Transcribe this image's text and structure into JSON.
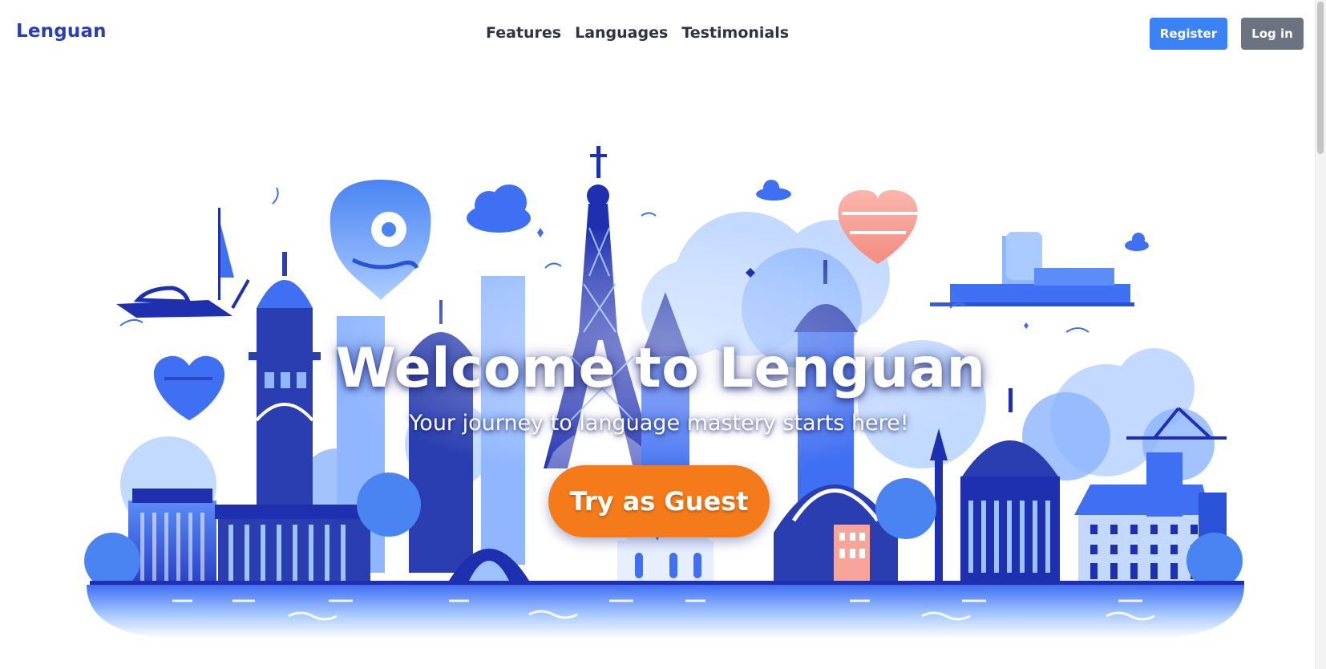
{
  "header": {
    "brand": "Lenguan",
    "nav": [
      {
        "label": "Features"
      },
      {
        "label": "Languages"
      },
      {
        "label": "Testimonials"
      }
    ],
    "register_label": "Register",
    "login_label": "Log in"
  },
  "hero": {
    "title": "Welcome to Lenguan",
    "subtitle": "Your journey to language mastery starts here!",
    "cta_label": "Try as Guest",
    "illustration": "city-skyline-landmarks-illustration"
  },
  "colors": {
    "brand": "#2a3eb1",
    "register": "#3b82f6",
    "login": "#6b7280",
    "cta": "#f47a1a",
    "illustration_dark": "#1e2fb0",
    "illustration_mid": "#3f6ff2",
    "illustration_light": "#9cc3ff",
    "heart_accent": "#f7a49a"
  }
}
